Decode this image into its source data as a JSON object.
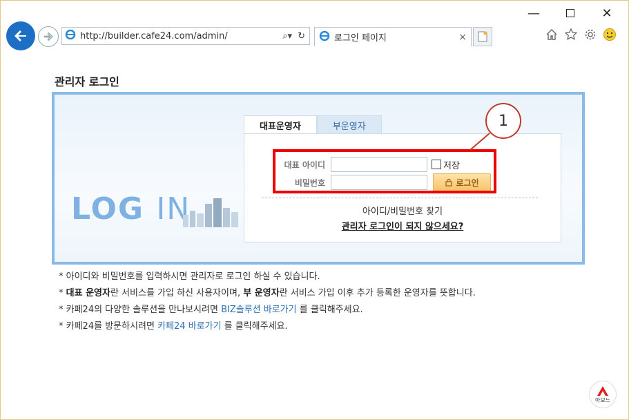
{
  "browser": {
    "url": "http://builder.cafe24.com/admin/",
    "tab_title": "로그인 페이지",
    "tab_close": "×"
  },
  "page": {
    "title": "관리자 로그인",
    "logo_text_bold": "LOG",
    "logo_text_thin": "IN",
    "tabs": [
      {
        "label": "대표운영자",
        "active": true
      },
      {
        "label": "부운영자",
        "active": false
      }
    ],
    "form": {
      "id_label": "대표 아이디",
      "id_value": "",
      "pw_label": "비밀번호",
      "pw_value": "",
      "save_label": "저장",
      "login_label": "로그인"
    },
    "find_link": "아이디/비밀번호 찾기",
    "help_link": "관리자 로그인이 되지 않으세요?",
    "callout_number": "1",
    "notes": {
      "n1": "* 아이디와 비밀번호를 입력하시면 관리자로 로그인 하실 수 있습니다.",
      "n2_prefix": "* ",
      "n2_bold1": "대표 운영자",
      "n2_mid": "란 서비스를 가입 하신 사용자이며, ",
      "n2_bold2": "부 운영자",
      "n2_suffix": "란 서비스 가입 이후 추가 등록한 운영자를 뜻합니다.",
      "n3_prefix": "* 카페24의 다양한 솔루션을 만나보시려면 ",
      "n3_link": "BIZ솔루션 바로가기",
      "n3_suffix": " 를 클릭해주세요.",
      "n4_prefix": "* 카페24를 방문하시려면 ",
      "n4_link": "카페24 바로가기",
      "n4_suffix": " 를 클릭해주세요."
    },
    "corner_logo_text": "아보느"
  },
  "colors": {
    "accent_blue": "#1d6fc6",
    "highlight_red": "#e00000",
    "link_blue": "#2c6fb7",
    "login_button": "#f7c46b"
  }
}
